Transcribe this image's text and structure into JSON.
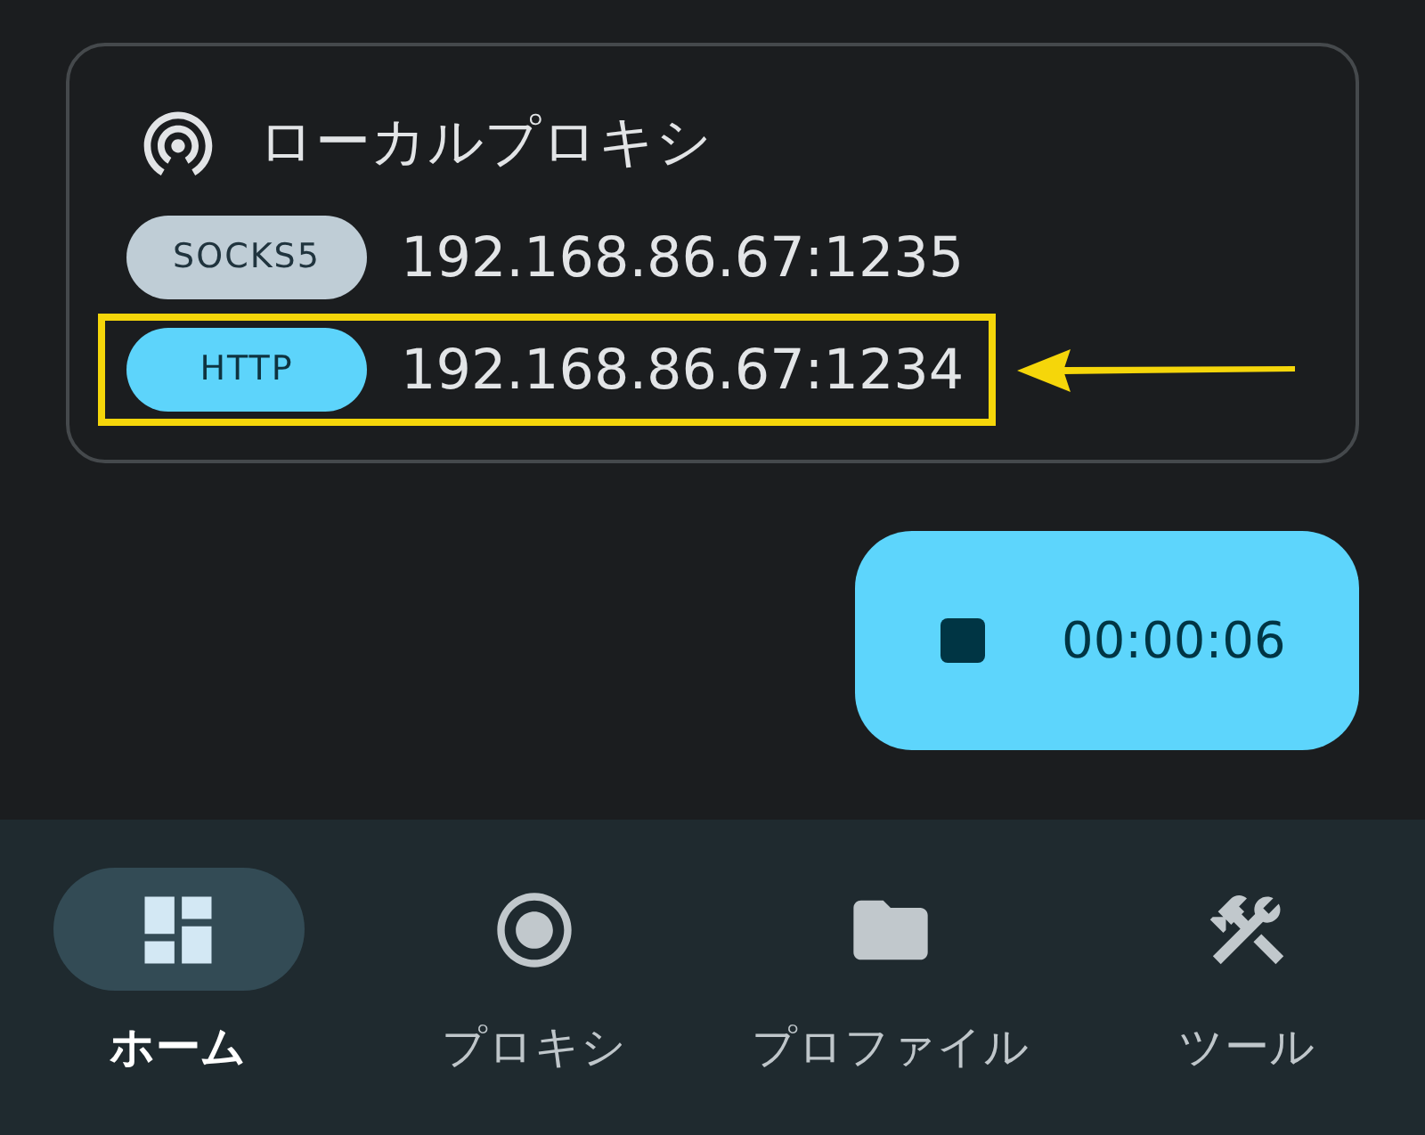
{
  "card": {
    "title": "ローカルプロキシ",
    "entries": [
      {
        "protocol": "SOCKS5",
        "address": "192.168.86.67:1235",
        "active": false,
        "highlighted": false
      },
      {
        "protocol": "HTTP",
        "address": "192.168.86.67:1234",
        "active": true,
        "highlighted": true
      }
    ]
  },
  "timer_button": {
    "label": "00:00:06"
  },
  "nav": {
    "items": [
      {
        "label": "ホーム",
        "selected": true
      },
      {
        "label": "プロキシ",
        "selected": false
      },
      {
        "label": "プロファイル",
        "selected": false
      },
      {
        "label": "ツール",
        "selected": false
      }
    ]
  }
}
